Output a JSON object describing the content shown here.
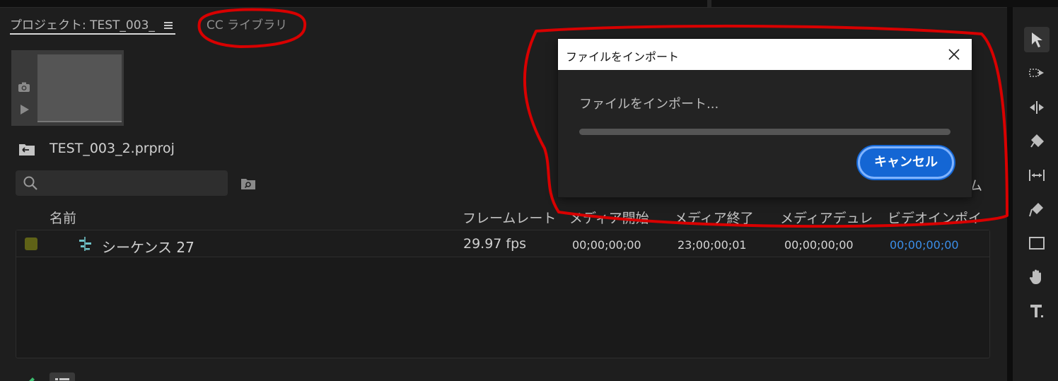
{
  "tabs": {
    "project_label": "プロジェクト: TEST_003_",
    "cc_libraries_label": "CC ライブラリ"
  },
  "project": {
    "file_name": "TEST_003_2.prproj"
  },
  "search": {
    "value": "",
    "placeholder": ""
  },
  "columns": {
    "name": "名前",
    "frame_rate": "フレームレート",
    "media_start": "メディア開始",
    "media_end": "メディア終了",
    "media_duration": "メディアデュレ",
    "video_in_point": "ビデオインポイ",
    "hidden_partial": "ム"
  },
  "rows": [
    {
      "label_color": "#5f6217",
      "icon": "sequence-icon",
      "name": "シーケンス 27",
      "frame_rate": "29.97 fps",
      "media_start": "00;00;00;00",
      "media_end": "23;00;00;01",
      "media_duration": "00;00;00;00",
      "video_in_point": "00;00;00;00"
    }
  ],
  "dialog": {
    "title": "ファイルをインポート",
    "message": "ファイルをインポート...",
    "progress": 0.0,
    "cancel_label": "キャンセル"
  },
  "tools": [
    "selection-tool-icon",
    "track-select-forward-icon",
    "ripple-edit-icon",
    "razor-icon",
    "slip-icon",
    "pen-icon",
    "rectangle-icon",
    "hand-icon",
    "type-icon"
  ],
  "colors": {
    "accent_blue": "#1466d4",
    "timecode_blue": "#3b8ee8",
    "annotation_red": "#e00000",
    "label_olive": "#5f6217"
  }
}
